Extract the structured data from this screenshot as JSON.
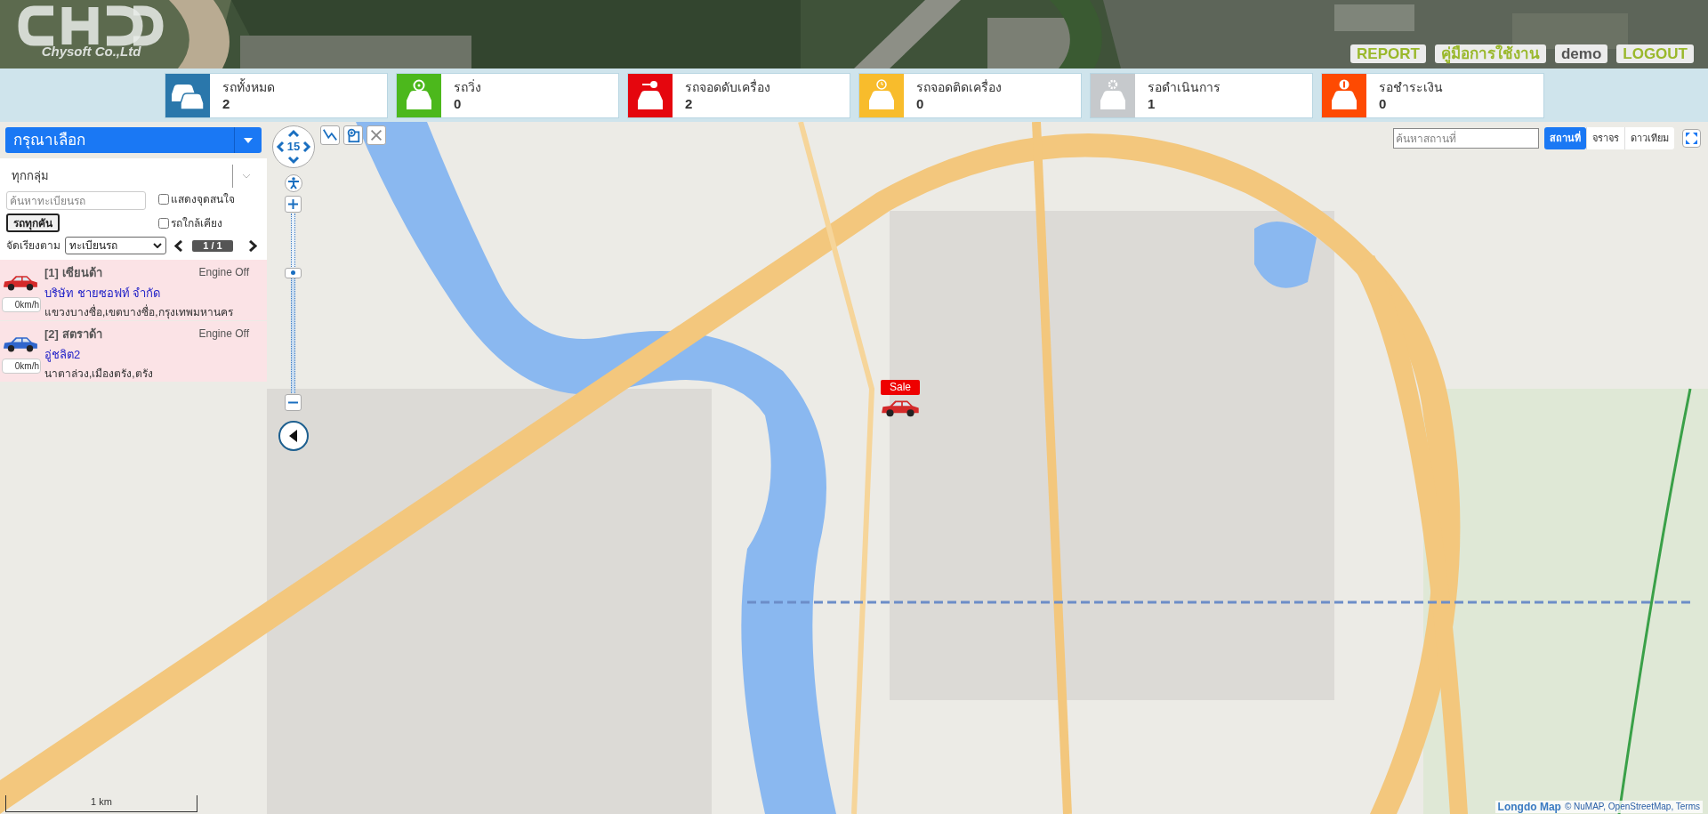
{
  "header": {
    "logo_text": "Chysoft Co.,Ltd",
    "buttons": [
      {
        "label": "REPORT",
        "kind": "link"
      },
      {
        "label": "คู่มือการใช้งาน",
        "kind": "link"
      },
      {
        "label": "demo",
        "kind": "user"
      },
      {
        "label": "LOGOUT",
        "kind": "link"
      }
    ]
  },
  "status_cards": [
    {
      "kind": "all",
      "label": "รถทั้งหมด",
      "count": "2",
      "color": "#2a77ab"
    },
    {
      "kind": "running",
      "label": "รถวิ่ง",
      "count": "0",
      "color": "#4cb81c"
    },
    {
      "kind": "engine_off",
      "label": "รถจอดดับเครื่อง",
      "count": "2",
      "color": "#e5060e"
    },
    {
      "kind": "idle",
      "label": "รถจอดติดเครื่อง",
      "count": "0",
      "color": "#f8bc2c"
    },
    {
      "kind": "pending",
      "label": "รอดำเนินการ",
      "count": "1",
      "color": "#c6c9cc"
    },
    {
      "kind": "payment",
      "label": "รอชำระเงิน",
      "count": "0",
      "color": "#fe4a02"
    }
  ],
  "vehicle_panel": {
    "selector": "กรุณาเลือก",
    "group": "ทุกกลุ่ม",
    "search_placeholder": "ค้นหาทะเบียนรถ",
    "all_button": "รถทุกคัน",
    "options": [
      {
        "label": "แสดงจุดสนใจ",
        "checked": false
      },
      {
        "label": "รถใกล้เคียง",
        "checked": false
      }
    ],
    "sort_label": "จัดเรียงตาม",
    "sort_value": "ทะเบียนรถ",
    "page": "1 / 1",
    "vehicles": [
      {
        "title": "[1] เซียนต้า",
        "status": "Engine Off",
        "company": "บริษัท ชายซอฟท์ จำกัด",
        "speed": "0km/h",
        "location": "แขวงบางซื่อ,เขตบางซื่อ,กรุงเทพมหานคร",
        "color": "#d42a2a"
      },
      {
        "title": "[2] สตราด้า",
        "status": "Engine Off",
        "company": "อู่ชลิต2",
        "speed": "0km/h",
        "location": "นาตาล่วง,เมืองตรัง,ตรัง",
        "color": "#2f66cc"
      }
    ]
  },
  "map": {
    "zoom": "15",
    "zoom_slider": {
      "level": 0.7
    },
    "place_search_placeholder": "ค้นหาสถานที่",
    "layers": [
      {
        "label": "สถานที่",
        "selected": true
      },
      {
        "label": "จราจร",
        "selected": false
      },
      {
        "label": "ดาวเทียม",
        "selected": false
      }
    ],
    "marker": {
      "label": "Sale",
      "color": "#d42a2a"
    },
    "scale": "1 km",
    "logo": "Longdo Map",
    "attribution": "© NuMAP, OpenStreetMap, Terms"
  }
}
